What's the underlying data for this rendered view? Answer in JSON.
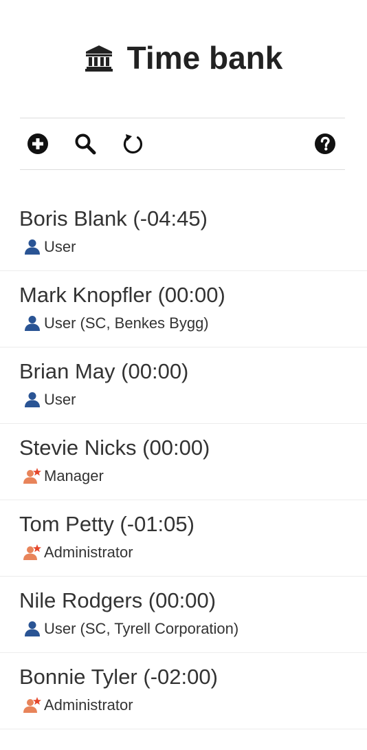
{
  "header": {
    "title": "Time bank",
    "icon": "bank-icon"
  },
  "toolbar": {
    "items": [
      {
        "name": "add",
        "icon": "plus-circle-icon"
      },
      {
        "name": "search",
        "icon": "search-icon"
      },
      {
        "name": "refresh",
        "icon": "refresh-icon"
      },
      {
        "name": "help",
        "icon": "question-circle-icon"
      }
    ]
  },
  "colors": {
    "user_icon": "#2a5494",
    "manager_icon": "#e8845a",
    "manager_star": "#e5462a",
    "text": "#333333",
    "divider": "#dcdcdc"
  },
  "users": [
    {
      "name": "Boris Blank (-04:45)",
      "role": "User",
      "role_type": "user"
    },
    {
      "name": "Mark Knopfler (00:00)",
      "role": "User (SC, Benkes Bygg)",
      "role_type": "user"
    },
    {
      "name": "Brian May (00:00)",
      "role": "User",
      "role_type": "user"
    },
    {
      "name": "Stevie Nicks (00:00)",
      "role": "Manager",
      "role_type": "manager"
    },
    {
      "name": "Tom Petty (-01:05)",
      "role": "Administrator",
      "role_type": "manager"
    },
    {
      "name": "Nile Rodgers (00:00)",
      "role": "User (SC, Tyrell Corporation)",
      "role_type": "user"
    },
    {
      "name": "Bonnie Tyler (-02:00)",
      "role": "Administrator",
      "role_type": "manager"
    }
  ]
}
